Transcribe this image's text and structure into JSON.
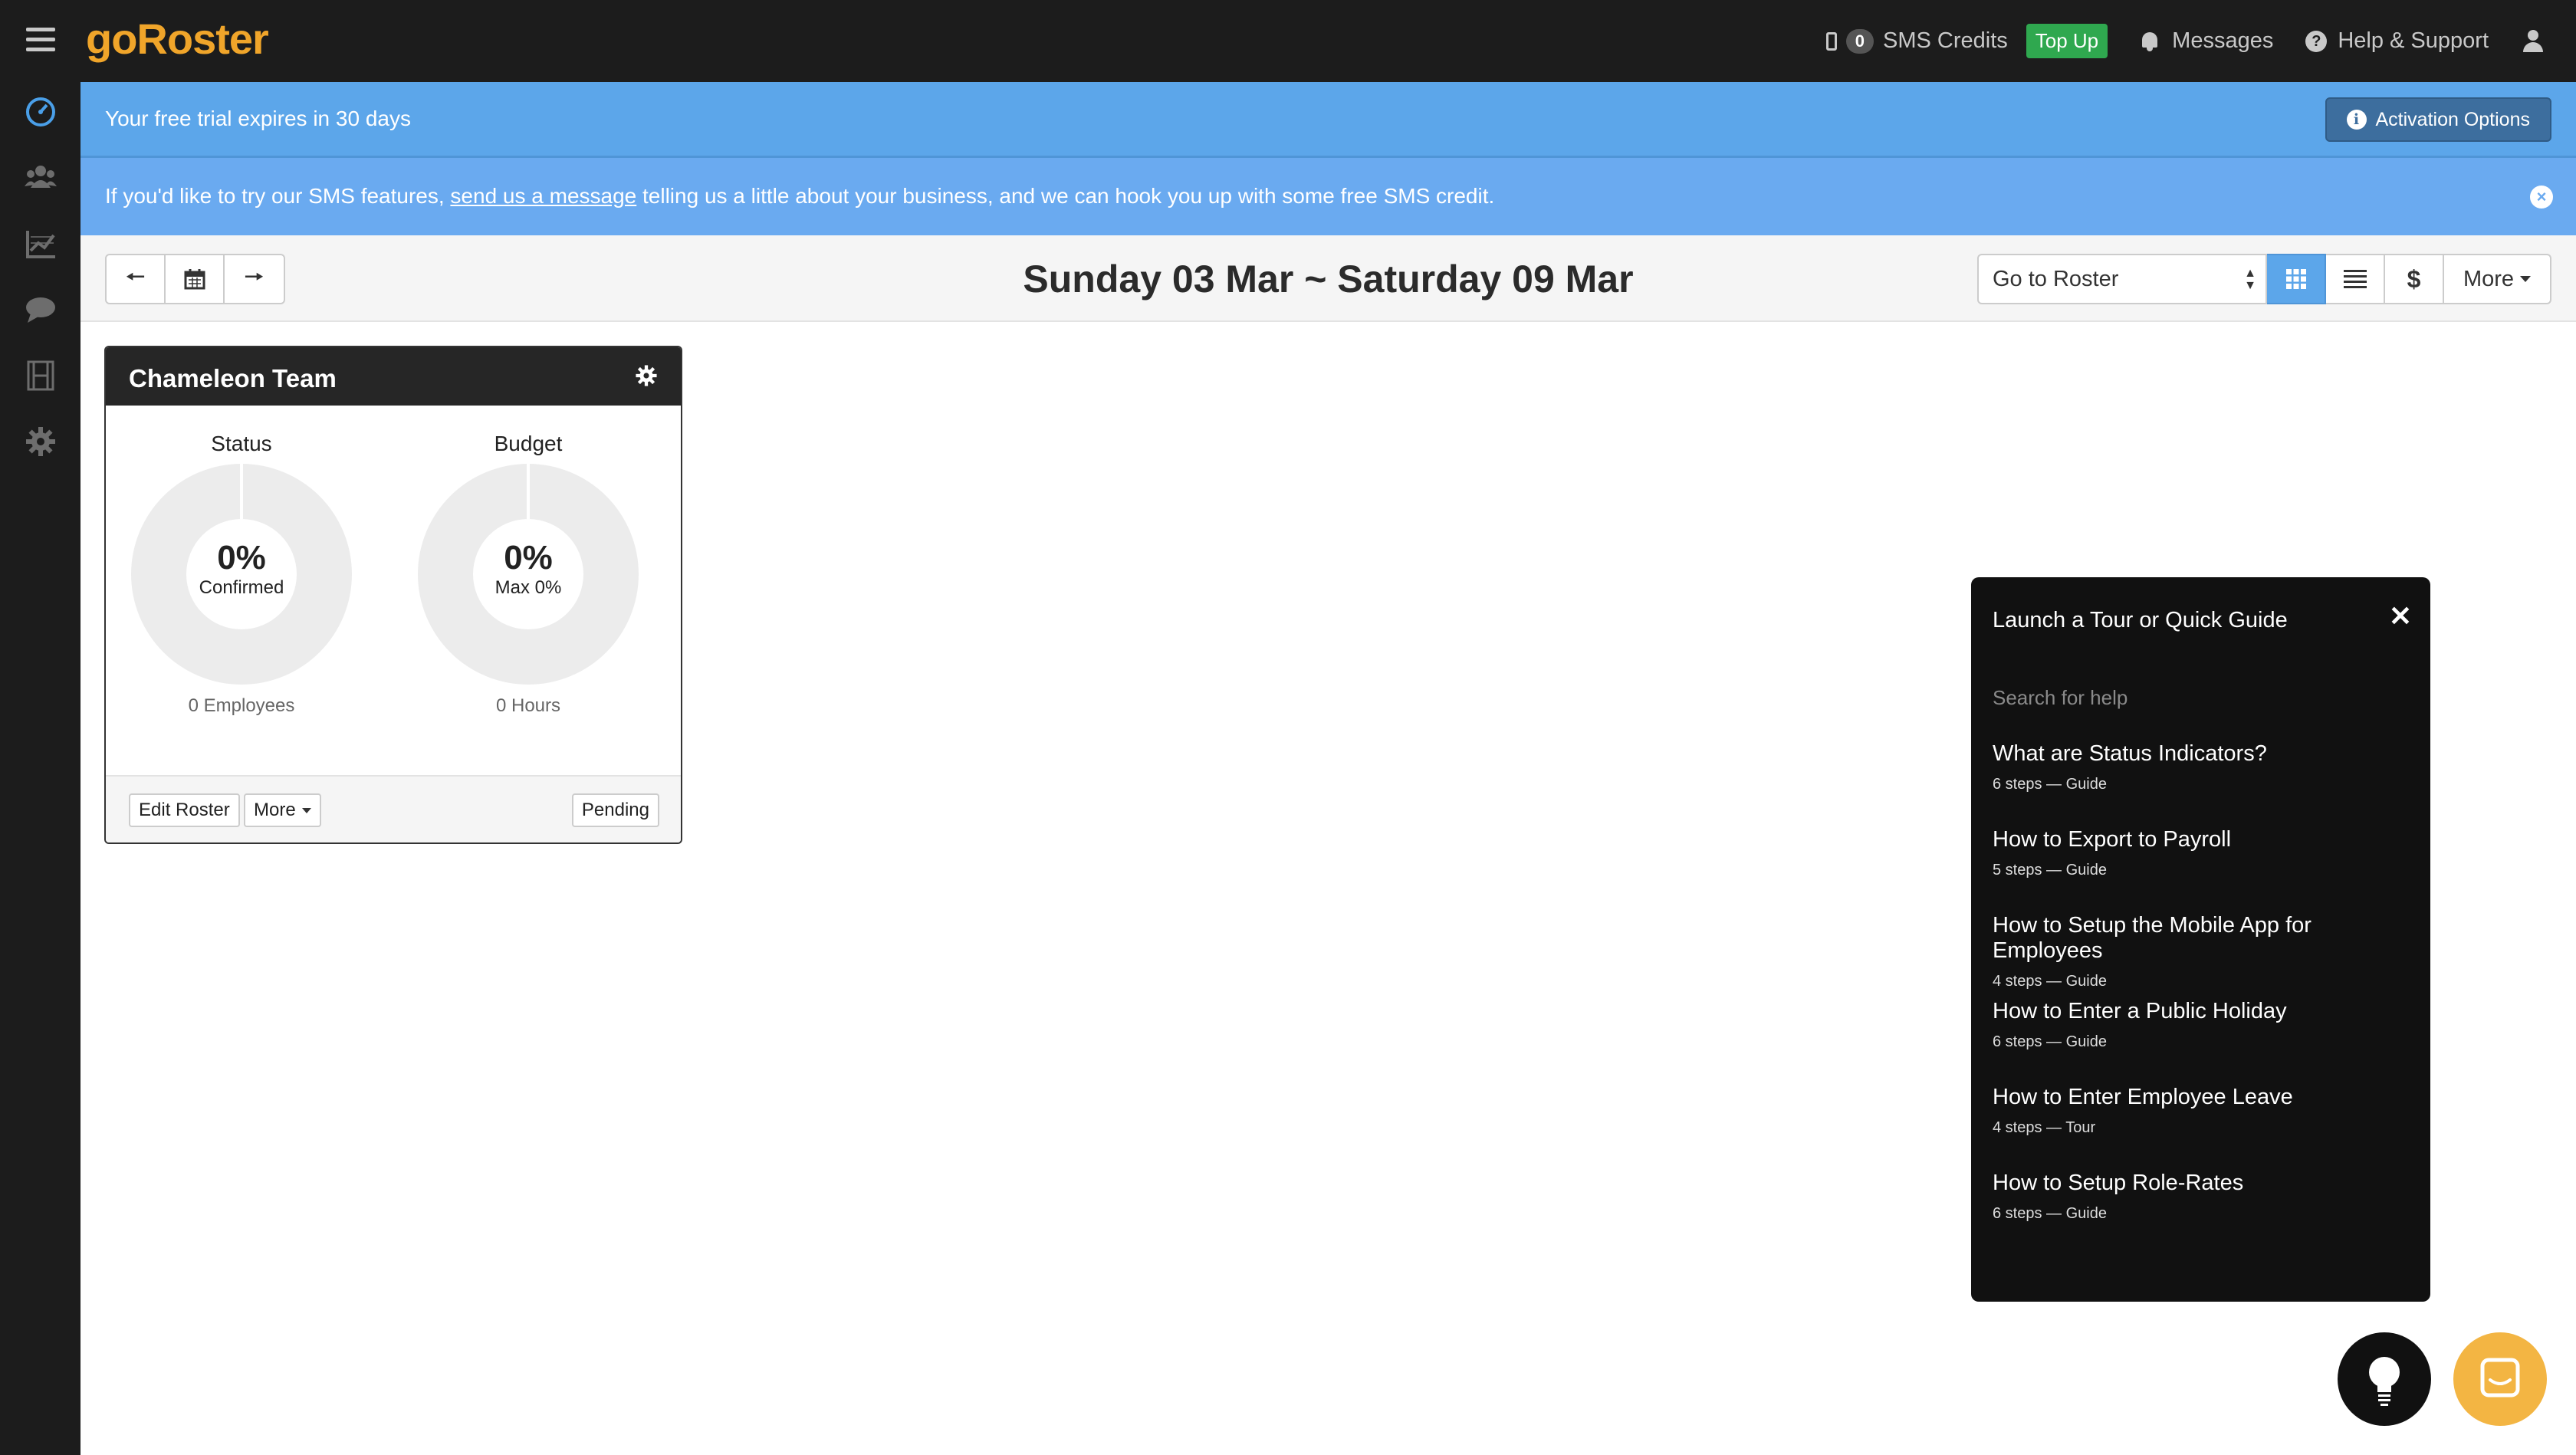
{
  "app": {
    "logo_go": "go",
    "logo_roster": "Roster"
  },
  "topbar": {
    "sms_count": "0",
    "sms_label": "SMS Credits",
    "topup_label": "Top Up",
    "messages_label": "Messages",
    "help_label": "Help & Support"
  },
  "sidebar": {
    "items": [
      {
        "icon": "dashboard-icon"
      },
      {
        "icon": "people-icon"
      },
      {
        "icon": "chart-icon"
      },
      {
        "icon": "chat-icon"
      },
      {
        "icon": "film-icon"
      },
      {
        "icon": "gear-icon"
      }
    ]
  },
  "trial_banner": {
    "text": "Your free trial expires in 30 days",
    "button_label": "Activation Options"
  },
  "sms_banner": {
    "text_before": "If you'd like to try our SMS features, ",
    "link_text": "send us a message",
    "text_after": " telling us a little about your business, and we can hook you up with some free SMS credit."
  },
  "toolbar": {
    "week_title": "Sunday 03 Mar ~ Saturday 09 Mar",
    "goto_value": "Go to Roster",
    "more_label": "More"
  },
  "team_card": {
    "name": "Chameleon Team",
    "status": {
      "label": "Status",
      "value": "0%",
      "sub": "Confirmed",
      "foot": "0 Employees"
    },
    "budget": {
      "label": "Budget",
      "value": "0%",
      "sub": "Max 0%",
      "foot": "0 Hours"
    },
    "edit_label": "Edit Roster",
    "more_label": "More",
    "pending_label": "Pending"
  },
  "help_panel": {
    "title": "Launch a Tour or Quick Guide",
    "search_placeholder": "Search for help",
    "guides": [
      {
        "title": "What are Status Indicators?",
        "meta": "6 steps — Guide"
      },
      {
        "title": "How to Export to Payroll",
        "meta": "5 steps — Guide"
      },
      {
        "title": "How to Setup the Mobile App for Employees",
        "meta": "4 steps — Guide"
      },
      {
        "title": "How to Enter a Public Holiday",
        "meta": "6 steps — Guide"
      },
      {
        "title": "How to Enter Employee Leave",
        "meta": "4 steps — Tour"
      },
      {
        "title": "How to Setup Role-Rates",
        "meta": "6 steps — Guide"
      }
    ]
  },
  "colors": {
    "topbar_bg": "#1c1c1c",
    "brand_orange": "#f0a52a",
    "banner_blue": "#5ca6ea",
    "topup_green": "#2fa84f",
    "chat_yellow": "#f3b543"
  }
}
